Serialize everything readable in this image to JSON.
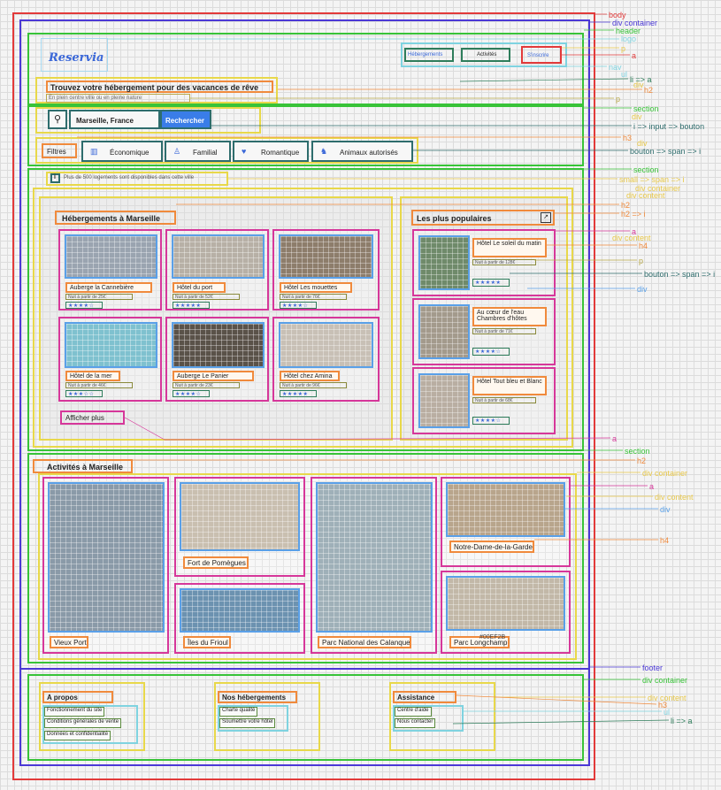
{
  "annotations": {
    "body": "body",
    "div_container_1": "div container",
    "header": "header",
    "logo": "logo",
    "p1": "p",
    "a1": "a",
    "nav": "nav",
    "ul": "ul",
    "li_a": "li => a",
    "div1": "div",
    "h2_1": "h2",
    "p2": "p",
    "section1": "section",
    "div2": "div",
    "i_input_bouton": "i => input => bouton",
    "h3_1": "h3",
    "div3": "div",
    "bouton_span_i_1": "bouton => span => i",
    "section2": "section",
    "small_span_i": "small => span => i",
    "div_container_2": "div container",
    "div_content_1": "div content",
    "h2_2": "h2",
    "h2_i": "h2 => i",
    "a2": "a",
    "div_content_2": "div content",
    "h4_1": "h4",
    "p3": "p",
    "bouton_span_i_2": "bouton => span => i",
    "div4": "div",
    "a3": "a",
    "section3": "section",
    "h2_3": "h2",
    "div_container_3": "div container",
    "a4": "a",
    "div_content_3": "div content",
    "div5": "div",
    "h4_2": "h4",
    "footer": "footer",
    "div_container_4": "div container",
    "div_content_4": "div content",
    "h3_2": "h3",
    "ul2": "ul",
    "li_a_2": "li => a"
  },
  "header": {
    "logo": "Reservia",
    "nav": [
      "Hébergements",
      "Activités"
    ],
    "signup": "S'inscrire",
    "title": "Trouvez votre hébergement pour des vacances de rêve",
    "subtitle": "En plein centre ville ou en pleine nature"
  },
  "search": {
    "location": "Marseille, France",
    "button": "Rechercher",
    "filters_label": "Filtres",
    "filters": [
      {
        "icon": "money-icon",
        "label": "Économique"
      },
      {
        "icon": "family-icon",
        "label": "Familial"
      },
      {
        "icon": "heart-icon",
        "label": "Romantique"
      },
      {
        "icon": "dog-icon",
        "label": "Animaux autorisés"
      }
    ]
  },
  "info": {
    "icon_glyph": "i",
    "text": "Plus de 500 logements sont disponibles dans cette ville"
  },
  "hebergements": {
    "title": "Hébergements à Marseille",
    "cards": [
      {
        "name": "Auberge la Cannebière",
        "price": "Nuit à partir de 25€",
        "stars": "★★★★☆",
        "rating": 4,
        "color": "#9aa4b0"
      },
      {
        "name": "Hôtel du port",
        "price": "Nuit à partir de 52€",
        "stars": "★★★★★",
        "rating": 5,
        "color": "#b7b0a6"
      },
      {
        "name": "Hôtel Les mouettes",
        "price": "Nuit à partir de 76€",
        "stars": "★★★★☆",
        "rating": 4,
        "color": "#8d7d6b"
      },
      {
        "name": "Hôtel de la mer",
        "price": "Nuit à partir de 46€",
        "stars": "★★★☆☆",
        "rating": 3,
        "color": "#7fc1cf"
      },
      {
        "name": "Auberge Le Panier",
        "price": "Nuit à partir de 23€",
        "stars": "★★★★☆",
        "rating": 4,
        "color": "#5a5249"
      },
      {
        "name": "Hôtel chez Amina",
        "price": "Nuit à partir de 96€",
        "stars": "★★★★★",
        "rating": 5,
        "color": "#c8c0b6"
      }
    ],
    "more": "Afficher plus"
  },
  "populaires": {
    "title": "Les plus populaires",
    "items": [
      {
        "name": "Hôtel Le soleil du matin",
        "price": "Nuit à partir de 128€",
        "stars": "★★★★★",
        "rating": 5,
        "color": "#6f8a6a"
      },
      {
        "name": "Au cœur de l'eau Chambres d'hôtes",
        "price": "Nuit à partir de 71€",
        "stars": "★★★★☆",
        "rating": 4,
        "color": "#a39a8c"
      },
      {
        "name": "Hôtel Tout bleu et Blanc",
        "price": "Nuit à partir de 68€",
        "stars": "★★★★☆",
        "rating": 4,
        "color": "#b9aea2"
      }
    ]
  },
  "activites": {
    "title": "Activités à Marseille",
    "items": [
      {
        "name": "Vieux Port",
        "color": "#8a9aa8"
      },
      {
        "name": "Fort de Pomègues",
        "color": "#c9bfb0"
      },
      {
        "name": "Îles du Frioul",
        "color": "#6c92b0"
      },
      {
        "name": "Parc National des Calanques",
        "color": "#9fb0b8"
      },
      {
        "name": "Notre-Dame-de-la-Garde",
        "color": "#b8a58c"
      },
      {
        "name": "Parc Longchamp",
        "color": "#c2b8a8"
      }
    ],
    "hex_label": "#00EF2B"
  },
  "footer": {
    "columns": [
      {
        "title": "A propos",
        "links": [
          "Fonctionnement du site",
          "Conditions générales de vente",
          "Données et confidentialité"
        ]
      },
      {
        "title": "Nos hébergements",
        "links": [
          "Charte qualité",
          "Soumettre votre hôtel"
        ]
      },
      {
        "title": "Assistance",
        "links": [
          "Centre d'aide",
          "Nous contacter"
        ]
      }
    ]
  }
}
